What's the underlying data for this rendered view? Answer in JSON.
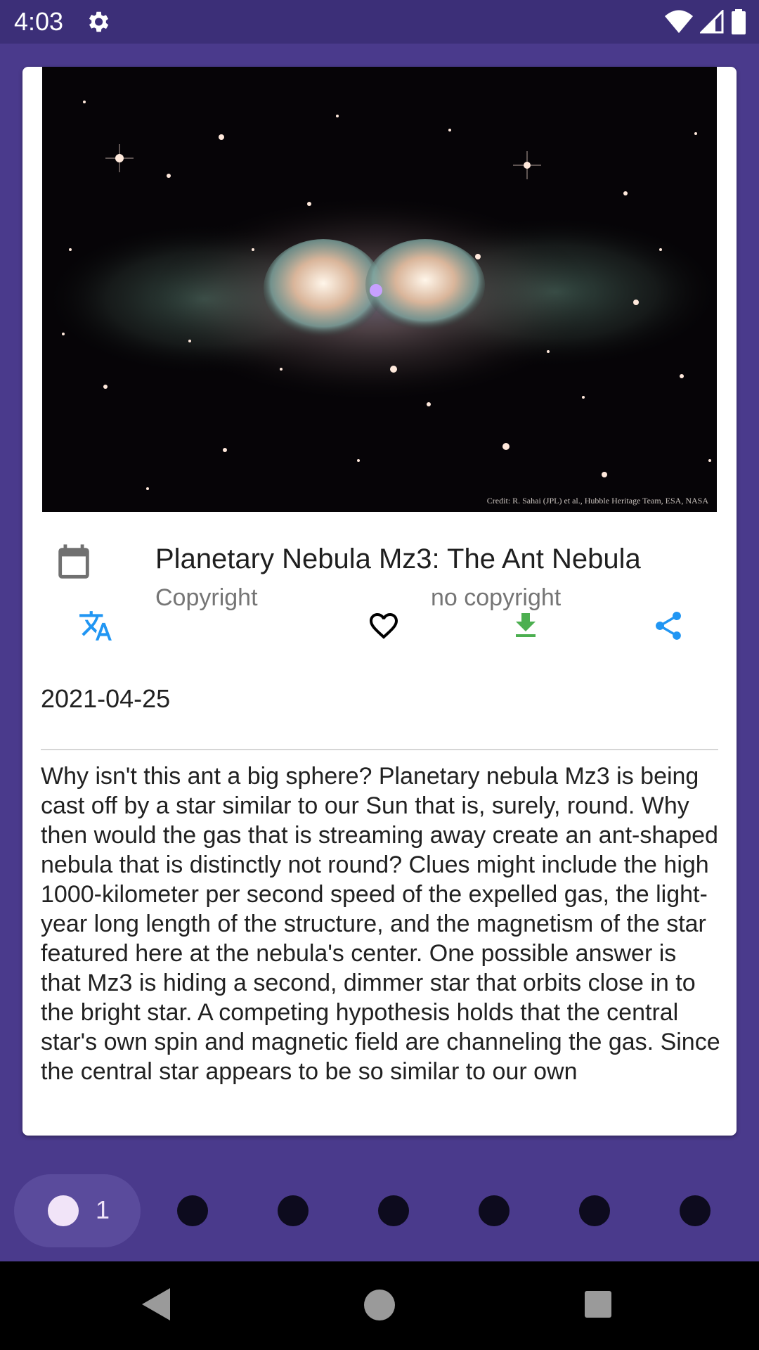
{
  "status_bar": {
    "time": "4:03",
    "icons": [
      "settings-icon",
      "wifi-icon",
      "signal-icon",
      "battery-icon"
    ]
  },
  "apod": {
    "image_credit": "Credit: R. Sahai (JPL) et al., Hubble Heritage Team, ESA, NASA",
    "title": "Planetary Nebula Mz3: The Ant Nebula",
    "copyright_label": "Copyright",
    "copyright_value": "no copyright",
    "date": "2021-04-25",
    "explanation": "Why isn't this ant a big sphere?  Planetary nebula Mz3 is being cast off by a star similar to our Sun that is, surely, round.  Why then would the gas that is streaming away create an ant-shaped nebula that is distinctly not round?  Clues might include the high 1000-kilometer per second speed of the expelled gas, the light-year long length of the structure, and the magnetism of the star featured here at the nebula's center.  One possible answer is that Mz3 is hiding a second, dimmer star that orbits close in to the bright star.  A competing hypothesis holds that the central star's own spin and magnetic field are channeling the gas.  Since the central star appears to be so similar to our own"
  },
  "actions": {
    "icons": [
      "calendar-icon",
      "translate-icon",
      "heart-icon",
      "download-icon",
      "share-icon"
    ],
    "colors": {
      "translate": "#2196f3",
      "favorite": "#000000",
      "download": "#4caf50",
      "share": "#2196f3"
    }
  },
  "page_indicator": {
    "active_page": "1",
    "total_dots": 7
  },
  "colors": {
    "background": "#4a3a8c",
    "status_bar": "#3c2f78",
    "card": "#ffffff"
  }
}
